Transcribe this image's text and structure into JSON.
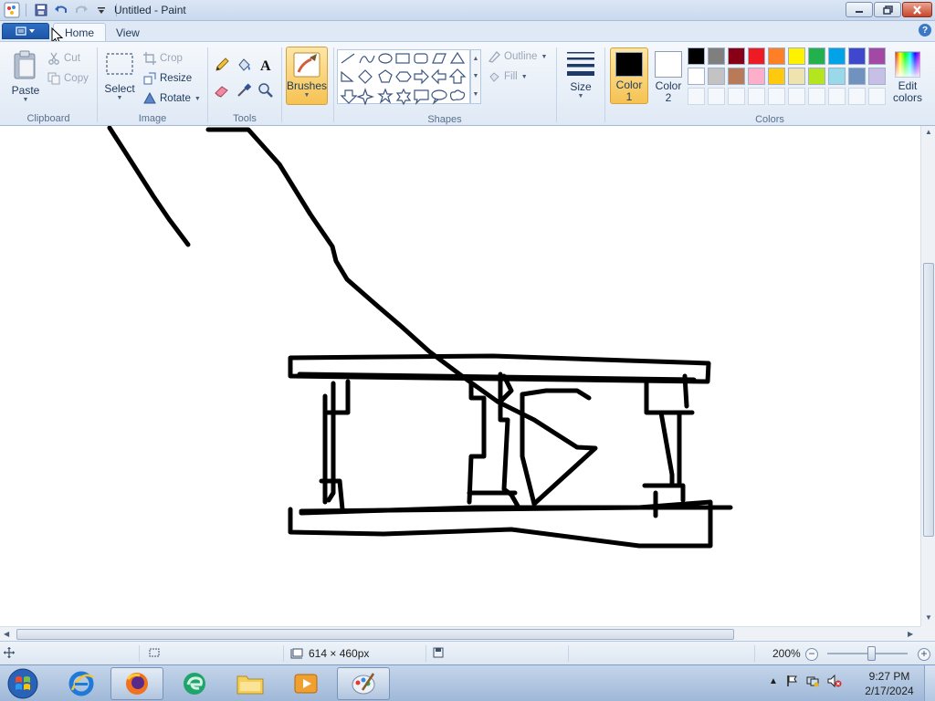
{
  "window": {
    "title": "Untitled - Paint"
  },
  "tabs": [
    {
      "label": "Home",
      "active": true
    },
    {
      "label": "View",
      "active": false
    }
  ],
  "ribbon": {
    "clipboard": {
      "label": "Clipboard",
      "paste": "Paste",
      "cut": "Cut",
      "copy": "Copy"
    },
    "image": {
      "label": "Image",
      "select": "Select",
      "crop": "Crop",
      "resize": "Resize",
      "rotate": "Rotate"
    },
    "tools": {
      "label": "Tools",
      "items": [
        "pencil-icon",
        "fill-icon",
        "text-icon",
        "eraser-icon",
        "color-picker-icon",
        "magnifier-icon"
      ]
    },
    "brushes": {
      "label": "Brushes"
    },
    "shapes": {
      "label": "Shapes",
      "outline": "Outline",
      "fill": "Fill",
      "items": [
        "line",
        "curve",
        "oval",
        "rectangle",
        "rounded-rectangle",
        "polygon",
        "triangle",
        "right-triangle",
        "diamond",
        "pentagon",
        "hexagon",
        "right-arrow",
        "left-arrow",
        "up-arrow",
        "down-arrow",
        "four-point-star",
        "five-point-star",
        "six-point-star",
        "rounded-callout",
        "oval-callout",
        "cloud-callout"
      ]
    },
    "size": {
      "label": "Size"
    },
    "colors": {
      "label": "Colors",
      "color1_label": "Color",
      "color1_num": "1",
      "color1": "#000000",
      "color2_label": "Color",
      "color2_num": "2",
      "color2": "#ffffff",
      "edit_label": "Edit",
      "edit_label2": "colors",
      "palette_row1": [
        "#000000",
        "#7f7f7f",
        "#880015",
        "#ed1c24",
        "#ff7f27",
        "#fff200",
        "#22b14c",
        "#00a2e8",
        "#3f48cc",
        "#a349a4"
      ],
      "palette_row2": [
        "#ffffff",
        "#c3c3c3",
        "#b97a57",
        "#ffaec9",
        "#ffc90e",
        "#efe4b0",
        "#b5e61d",
        "#99d9ea",
        "#7092be",
        "#c8bfe7"
      ]
    }
  },
  "status": {
    "canvas_size": "614 × 460px",
    "zoom": "200%"
  },
  "taskbar": {
    "apps": [
      "internet-explorer",
      "firefox",
      "edge",
      "file-explorer",
      "media-player",
      "paint"
    ],
    "time": "9:27 PM",
    "date": "2/17/2024"
  }
}
